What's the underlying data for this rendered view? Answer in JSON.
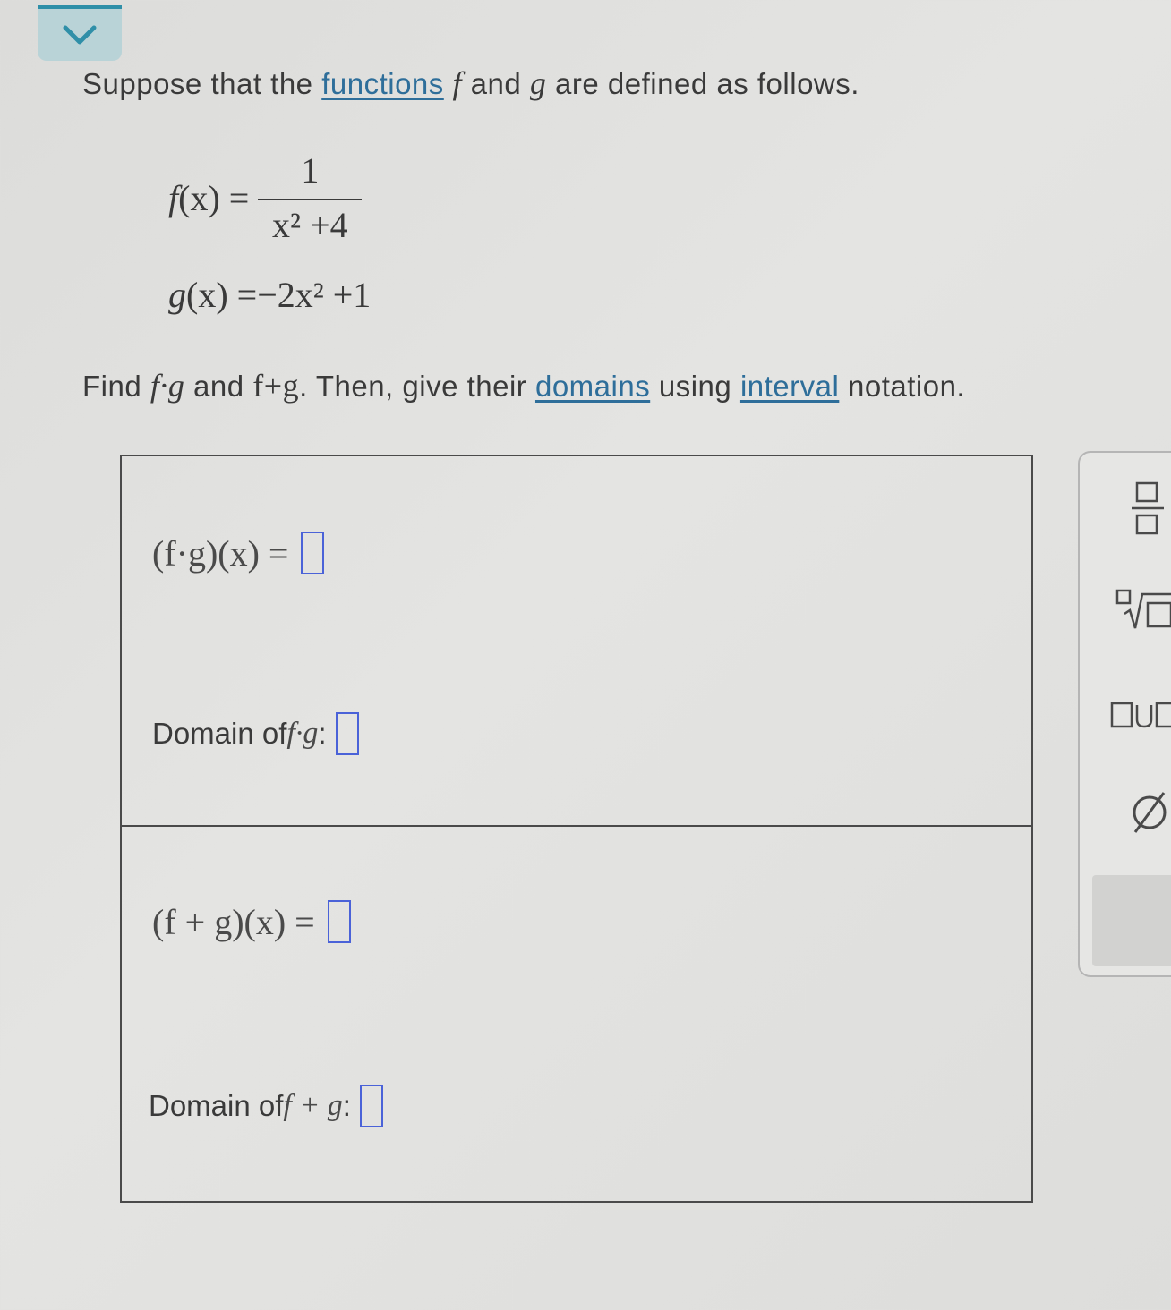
{
  "intro": {
    "prefix": "Suppose that the ",
    "link_functions": "functions",
    "f": "f",
    "mid1": " and ",
    "g": "g",
    "suffix": " are defined as follows."
  },
  "definitions": {
    "f_lhs": "f",
    "f_arg": "(x) =",
    "f_numerator": "1",
    "f_denominator": "x² +4",
    "g_lhs": "g",
    "g_rhs": "(x) =−2x² +1"
  },
  "find": {
    "prefix": "Find ",
    "fg": "f·g",
    "mid": " and ",
    "fplusg": "f+g",
    "mid2": ". Then, give their ",
    "link_domains": "domains",
    "mid3": " using ",
    "link_interval": "interval",
    "suffix": " notation."
  },
  "answers": {
    "product_label": "(f·g)(x) =",
    "product_domain_prefix": "Domain of ",
    "product_domain_expr": "f·g",
    "product_domain_colon": " :",
    "sum_label": "(f + g)(x) =",
    "sum_domain_prefix": "Domain of ",
    "sum_domain_expr": "f + g",
    "sum_domain_colon": " :"
  },
  "toolbox": {
    "tools": [
      "fraction-tool",
      "nth-root-tool",
      "union-tool",
      "empty-set-tool"
    ],
    "empty_set_symbol": "∅",
    "union_symbol": "U"
  },
  "colors": {
    "accent": "#2f8fa8",
    "link": "#2e6e9a",
    "input_border": "#4a62d8"
  }
}
